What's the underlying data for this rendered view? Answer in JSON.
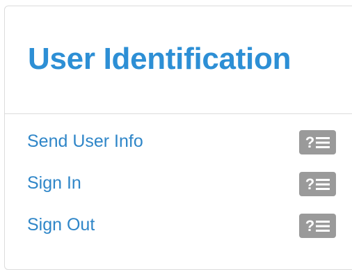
{
  "panel": {
    "title": "User Identification",
    "items": [
      {
        "label": "Send User Info",
        "help_glyph": "?",
        "help_icon": "help-list-icon"
      },
      {
        "label": "Sign In",
        "help_glyph": "?",
        "help_icon": "help-list-icon"
      },
      {
        "label": "Sign Out",
        "help_glyph": "?",
        "help_icon": "help-list-icon"
      }
    ]
  },
  "colors": {
    "title": "#2d8fd5",
    "link": "#2f86c8",
    "badge": "#9a9a9a",
    "border": "#dcdcdc"
  }
}
